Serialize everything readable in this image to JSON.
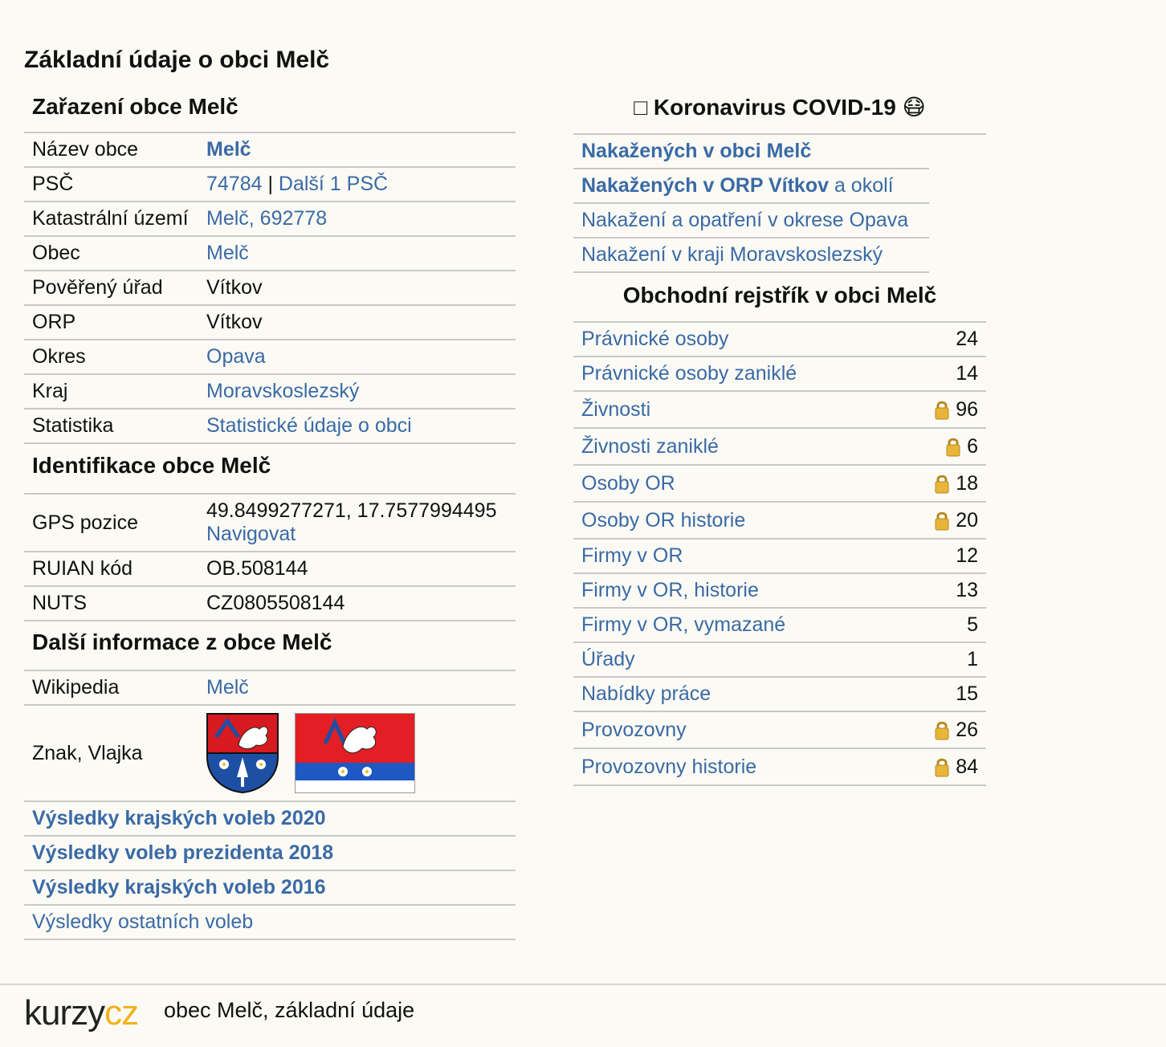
{
  "page_title": "Základní údaje o obci Melč",
  "zarazeni": {
    "heading": "Zařazení obce Melč",
    "rows": [
      {
        "label": "Název obce",
        "value": "Melč"
      },
      {
        "label": "PSČ",
        "value_a": "74784",
        "sep": " | ",
        "value_b": "Další 1 PSČ"
      },
      {
        "label": "Katastrální území",
        "value": "Melč, 692778"
      },
      {
        "label": "Obec",
        "value": "Melč"
      },
      {
        "label": "Pověřený úřad",
        "value": "Vítkov"
      },
      {
        "label": "ORP",
        "value": "Vítkov"
      },
      {
        "label": "Okres",
        "value": "Opava"
      },
      {
        "label": "Kraj",
        "value": "Moravskoslezský"
      },
      {
        "label": "Statistika",
        "value": "Statistické údaje o obci"
      }
    ]
  },
  "identifikace": {
    "heading": "Identifikace obce Melč",
    "gps_label": "GPS pozice",
    "gps_value": "49.8499277271, 17.7577994495",
    "gps_link": "Navigovat",
    "ruian_label": "RUIAN kód",
    "ruian_value": "OB.508144",
    "nuts_label": "NUTS",
    "nuts_value": "CZ0805508144"
  },
  "dalsi": {
    "heading": "Další informace z obce Melč",
    "wiki_label": "Wikipedia",
    "wiki_value": "Melč",
    "znak_label": "Znak, Vlajka"
  },
  "volby": [
    "Výsledky krajských voleb 2020",
    "Výsledky voleb prezidenta 2018",
    "Výsledky krajských voleb 2016",
    "Výsledky ostatních voleb"
  ],
  "covid": {
    "heading_icon": "□",
    "heading": "Koronavirus COVID-19",
    "heading_emoji": "😷",
    "row1_bold": "Nakažených v obci Melč",
    "row2_bold": "Nakažených v ORP Vítkov",
    "row2_rest": " a okolí",
    "row3": "Nakažení a opatření v okrese Opava",
    "row4": "Nakažení v kraji Moravskoslezský"
  },
  "obchodni": {
    "heading": "Obchodní rejstřík v obci Melč",
    "rows": [
      {
        "label": "Právnické osoby",
        "value": "24",
        "lock": false
      },
      {
        "label": "Právnické osoby zaniklé",
        "value": "14",
        "lock": false
      },
      {
        "label": "Živnosti",
        "value": "96",
        "lock": true
      },
      {
        "label": "Živnosti zaniklé",
        "value": "6",
        "lock": true
      },
      {
        "label": "Osoby OR",
        "value": "18",
        "lock": true
      },
      {
        "label": "Osoby OR historie",
        "value": "20",
        "lock": true
      },
      {
        "label": "Firmy v OR",
        "value": "12",
        "lock": false
      },
      {
        "label": "Firmy v OR, historie",
        "value": "13",
        "lock": false
      },
      {
        "label": "Firmy v OR, vymazané",
        "value": "5",
        "lock": false
      },
      {
        "label": "Úřady",
        "value": "1",
        "lock": false
      },
      {
        "label": "Nabídky práce",
        "value": "15",
        "lock": false
      },
      {
        "label": "Provozovny",
        "value": "26",
        "lock": true
      },
      {
        "label": "Provozovny historie",
        "value": "84",
        "lock": true
      }
    ]
  },
  "footer": {
    "logo_a": "kurzy",
    "logo_b": "cz",
    "text": "obec Melč, základní údaje"
  },
  "colors": {
    "link": "#3a6aa5",
    "background": "#fbfaf5",
    "divider": "#c9c9c9",
    "logo_accent": "#f2b21b"
  }
}
